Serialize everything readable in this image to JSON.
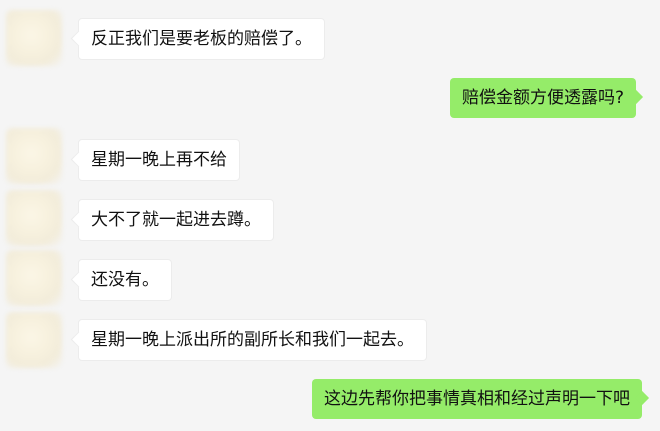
{
  "messages": [
    {
      "side": "left",
      "text": "反正我们是要老板的赔偿了。"
    },
    {
      "side": "right",
      "text": "赔偿金额方便透露吗?"
    },
    {
      "side": "left",
      "text": "星期一晚上再不给"
    },
    {
      "side": "left",
      "text": "大不了就一起进去蹲。"
    },
    {
      "side": "left",
      "text": "还没有。"
    },
    {
      "side": "left",
      "text": "星期一晚上派出所的副所长和我们一起去。"
    },
    {
      "side": "right",
      "text": "这边先帮你把事情真相和经过声明一下吧"
    }
  ]
}
